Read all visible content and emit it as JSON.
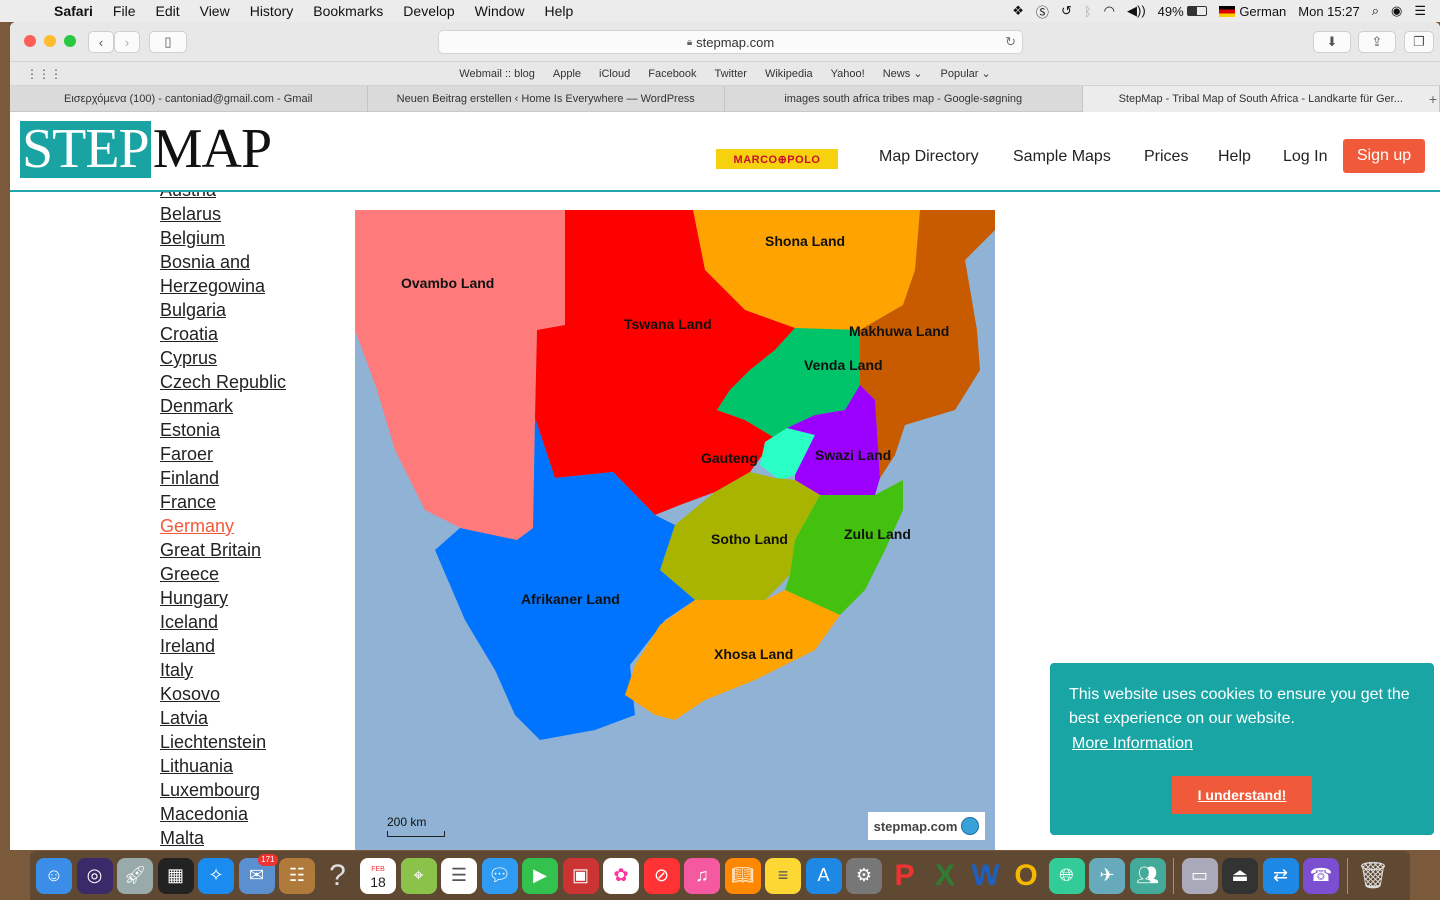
{
  "menubar": {
    "app": "Safari",
    "items": [
      "File",
      "Edit",
      "View",
      "History",
      "Bookmarks",
      "Develop",
      "Window",
      "Help"
    ],
    "battery": "49%",
    "input_source": "German",
    "clock": "Mon 15:27"
  },
  "browser": {
    "url": "stepmap.com",
    "favorites": [
      "Webmail :: blog",
      "Apple",
      "iCloud",
      "Facebook",
      "Twitter",
      "Wikipedia",
      "Yahoo!",
      "News",
      "Popular"
    ],
    "tabs": [
      "Εισερχόμενα (100) - cantoniad@gmail.com - Gmail",
      "Neuen Beitrag erstellen ‹ Home Is Everywhere — WordPress",
      "images south africa tribes map - Google-søgning",
      "StepMap - Tribal Map of South Africa - Landkarte für Ger..."
    ]
  },
  "site": {
    "logo_left": "STEP",
    "logo_right": "MAP",
    "partner": "MARCO⊕POLO",
    "nav": [
      "Map Directory",
      "Sample Maps",
      "Prices",
      "Help",
      "Log In"
    ],
    "signup": "Sign up"
  },
  "countries": {
    "partial": "Austria",
    "items": [
      "Belarus",
      "Belgium",
      "Bosnia and",
      "Herzegowina",
      "Bulgaria",
      "Croatia",
      "Cyprus",
      "Czech Republic",
      "Denmark",
      "Estonia",
      "Faroer",
      "Finland",
      "France",
      "Germany",
      "Great Britain",
      "Greece",
      "Hungary",
      "Iceland",
      "Ireland",
      "Italy",
      "Kosovo",
      "Latvia",
      "Liechtenstein",
      "Lithuania",
      "Luxembourg",
      "Macedonia",
      "Malta"
    ],
    "highlighted": "Germany"
  },
  "map": {
    "labels": [
      "Ovambo Land",
      "Shona Land",
      "Tswana Land",
      "Makhuwa Land",
      "Venda Land",
      "Gauteng",
      "Swazi Land",
      "Sotho Land",
      "Zulu Land",
      "Afrikaner Land",
      "Xhosa Land"
    ],
    "scale": "200 km",
    "brand": "stepmap.com",
    "colors": {
      "sea": "#8fb2d5",
      "ovambo": "#ff7b7b",
      "tswana": "#ff0000",
      "shona": "#ffa300",
      "makhuwa": "#c85a00",
      "venda": "#00c46a",
      "gauteng": "#2affc6",
      "swazi": "#9b00ff",
      "sotho": "#a8b400",
      "zulu": "#44c10f",
      "afrikaner": "#0073ff",
      "xhosa": "#ffa300"
    }
  },
  "cookie": {
    "message": "This website uses cookies to ensure you get the best experience on our website.",
    "link": "More Information",
    "button": "I understand!"
  },
  "dock": {
    "mail_badge": "171",
    "calendar_month": "FEB",
    "calendar_day": "18"
  }
}
